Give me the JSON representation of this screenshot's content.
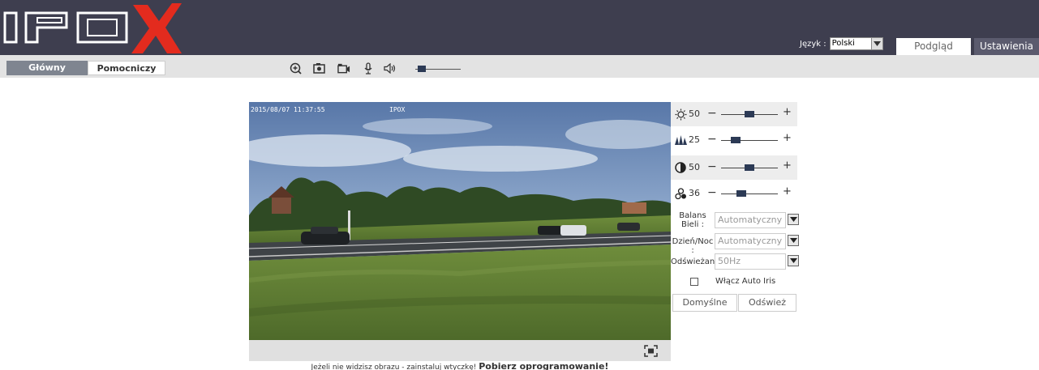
{
  "header": {
    "logo_text": "IPOX",
    "language_label": "Język :",
    "language_value": "Polski",
    "tabs": [
      {
        "label": "Podgląd",
        "active": true
      },
      {
        "label": "Ustawienia",
        "active": false
      }
    ]
  },
  "stream_tabs": [
    {
      "label": "Główny",
      "active": true
    },
    {
      "label": "Pomocniczy",
      "active": false
    }
  ],
  "toolbar": {
    "icons": [
      "zoom-in-icon",
      "snapshot-icon",
      "record-icon",
      "microphone-icon",
      "speaker-icon"
    ],
    "volume_level": 0.15
  },
  "video": {
    "osd_timestamp": "2015/08/07 11:37:55",
    "osd_name": "IPOX"
  },
  "image_settings": {
    "sliders": [
      {
        "icon": "brightness-icon",
        "value": "50",
        "level": 0.5
      },
      {
        "icon": "sharpness-icon",
        "value": "25",
        "level": 0.25
      },
      {
        "icon": "contrast-icon",
        "value": "50",
        "level": 0.5
      },
      {
        "icon": "saturation-icon",
        "value": "36",
        "level": 0.36
      }
    ],
    "minus_label": "−",
    "plus_label": "+",
    "white_balance": {
      "label_line1": "Balans",
      "label_line2": "Bieli :",
      "value": "Automatyczny"
    },
    "day_night": {
      "label": "Dzień/Noc :",
      "value": "Automatyczny"
    },
    "refresh_rate": {
      "label": "Odświeżanie",
      "value": "50Hz"
    },
    "auto_iris": {
      "label": "Włącz Auto Iris",
      "checked": false
    },
    "buttons": {
      "default": "Domyślne",
      "refresh": "Odśwież"
    }
  },
  "footer": {
    "message": "Jeżeli nie widzisz obrazu - zainstaluj wtyczkę!",
    "download_link": "Pobierz oprogramowanie!"
  },
  "colors": {
    "header_bg": "#3e3e4f",
    "logo_red": "#e32b1e",
    "active_stream_tab": "#7f8590",
    "slider_thumb": "#2c3a55"
  }
}
